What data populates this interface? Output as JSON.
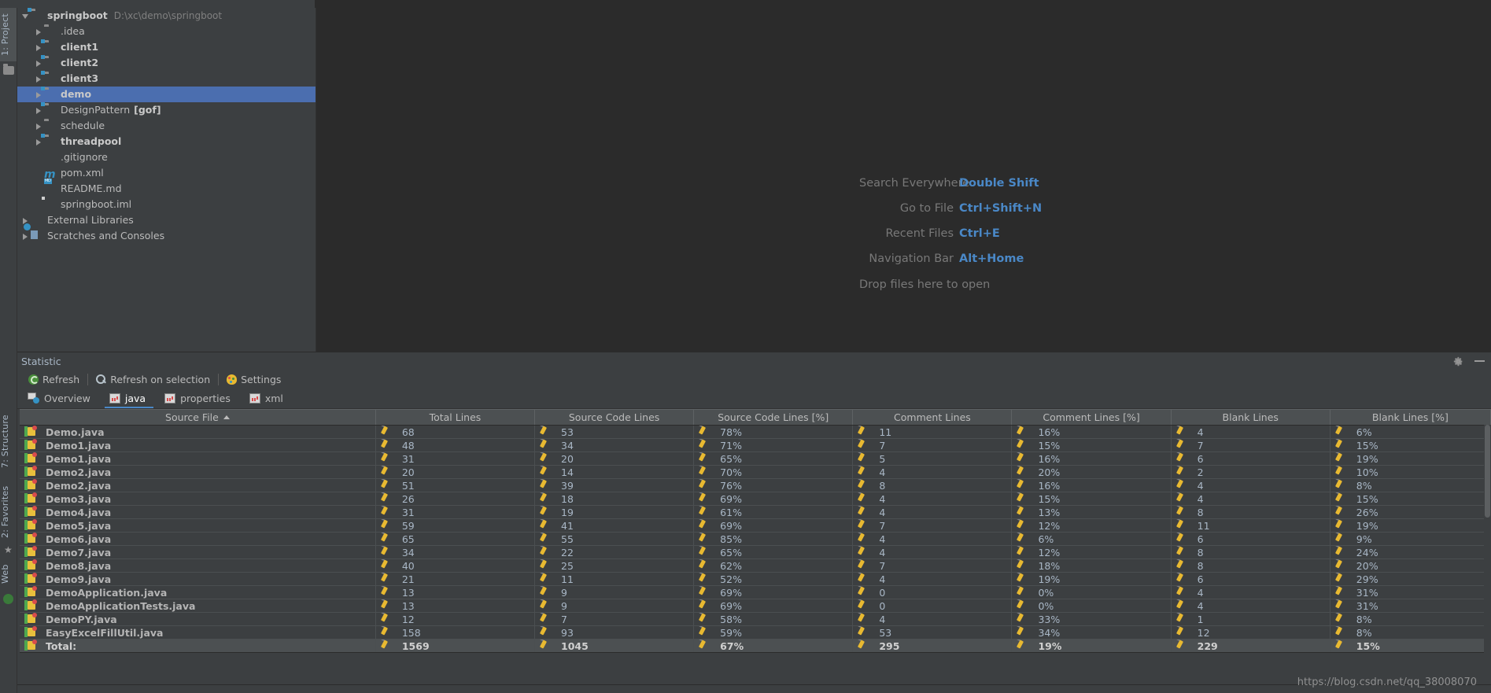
{
  "vertical_tabs_left": [
    {
      "label": "1: Project",
      "num": "1",
      "selected": true
    },
    {
      "label": "7: Structure",
      "num": "7",
      "selected": false
    },
    {
      "label": "2: Favorites",
      "num": "2",
      "selected": false
    },
    {
      "label": "Web",
      "num": "",
      "selected": false
    }
  ],
  "project_tree": {
    "items": [
      {
        "label": "springboot",
        "path": "D:\\xc\\demo\\springboot",
        "icon": "folder-module-icon",
        "arrow": "open",
        "indent": 0,
        "bold": true,
        "selected": false,
        "suffix": ""
      },
      {
        "label": ".idea",
        "path": "",
        "icon": "folder-icon",
        "arrow": "closed",
        "indent": 1,
        "bold": false,
        "selected": false,
        "suffix": ""
      },
      {
        "label": "client1",
        "path": "",
        "icon": "folder-module-icon",
        "arrow": "closed",
        "indent": 1,
        "bold": true,
        "selected": false,
        "suffix": ""
      },
      {
        "label": "client2",
        "path": "",
        "icon": "folder-module-icon",
        "arrow": "closed",
        "indent": 1,
        "bold": true,
        "selected": false,
        "suffix": ""
      },
      {
        "label": "client3",
        "path": "",
        "icon": "folder-module-icon",
        "arrow": "closed",
        "indent": 1,
        "bold": true,
        "selected": false,
        "suffix": ""
      },
      {
        "label": "demo",
        "path": "",
        "icon": "folder-module-icon",
        "arrow": "closed",
        "indent": 1,
        "bold": true,
        "selected": true,
        "suffix": ""
      },
      {
        "label": "DesignPattern",
        "path": "",
        "icon": "folder-module-icon",
        "arrow": "closed",
        "indent": 1,
        "bold": false,
        "selected": false,
        "suffix": "[gof]"
      },
      {
        "label": "schedule",
        "path": "",
        "icon": "folder-icon",
        "arrow": "closed",
        "indent": 1,
        "bold": false,
        "selected": false,
        "suffix": ""
      },
      {
        "label": "threadpool",
        "path": "",
        "icon": "folder-module-icon",
        "arrow": "closed",
        "indent": 1,
        "bold": true,
        "selected": false,
        "suffix": ""
      },
      {
        "label": ".gitignore",
        "path": "",
        "icon": "file-icon",
        "arrow": "none",
        "indent": 1,
        "bold": false,
        "selected": false,
        "suffix": ""
      },
      {
        "label": "pom.xml",
        "path": "",
        "icon": "maven-icon",
        "arrow": "none",
        "indent": 1,
        "bold": false,
        "selected": false,
        "suffix": ""
      },
      {
        "label": "README.md",
        "path": "",
        "icon": "markdown-icon",
        "arrow": "none",
        "indent": 1,
        "bold": false,
        "selected": false,
        "suffix": ""
      },
      {
        "label": "springboot.iml",
        "path": "",
        "icon": "iml-icon",
        "arrow": "none",
        "indent": 1,
        "bold": false,
        "selected": false,
        "suffix": ""
      },
      {
        "label": "External Libraries",
        "path": "",
        "icon": "libraries-icon",
        "arrow": "closed",
        "indent": 0,
        "bold": false,
        "selected": false,
        "suffix": ""
      },
      {
        "label": "Scratches and Consoles",
        "path": "",
        "icon": "scratches-icon",
        "arrow": "closed",
        "indent": 0,
        "bold": false,
        "selected": false,
        "suffix": ""
      }
    ]
  },
  "editor_hints": [
    {
      "label": "Search Everywhere",
      "key": "Double Shift"
    },
    {
      "label": "Go to File",
      "key": "Ctrl+Shift+N"
    },
    {
      "label": "Recent Files",
      "key": "Ctrl+E"
    },
    {
      "label": "Navigation Bar",
      "key": "Alt+Home"
    },
    {
      "label": "Drop files here to open",
      "key": ""
    }
  ],
  "statistic": {
    "title": "Statistic",
    "settings_icon": "gear-icon",
    "minimize_icon": "minimize-icon",
    "toolbar": [
      {
        "label": "Refresh",
        "icon": "refresh-icon"
      },
      {
        "label": "Refresh on selection",
        "icon": "magnifier-icon"
      },
      {
        "label": "Settings",
        "icon": "palette-icon"
      }
    ],
    "tabs": [
      {
        "label": "Overview",
        "icon": "overview-icon",
        "active": false
      },
      {
        "label": "java",
        "icon": "chart-icon",
        "active": true
      },
      {
        "label": "properties",
        "icon": "chart-icon",
        "active": false
      },
      {
        "label": "xml",
        "icon": "chart-icon",
        "active": false
      }
    ]
  },
  "chart_data": {
    "type": "table",
    "title": "Statistic - java",
    "sort_column": "Source File",
    "sort_direction": "asc",
    "columns": [
      "Source File",
      "Total Lines",
      "Source Code Lines",
      "Source Code Lines [%]",
      "Comment Lines",
      "Comment Lines [%]",
      "Blank Lines",
      "Blank Lines [%]"
    ],
    "rows": [
      [
        "Demo.java",
        "68",
        "53",
        "78%",
        "11",
        "16%",
        "4",
        "6%"
      ],
      [
        "Demo1.java",
        "48",
        "34",
        "71%",
        "7",
        "15%",
        "7",
        "15%"
      ],
      [
        "Demo1.java",
        "31",
        "20",
        "65%",
        "5",
        "16%",
        "6",
        "19%"
      ],
      [
        "Demo2.java",
        "20",
        "14",
        "70%",
        "4",
        "20%",
        "2",
        "10%"
      ],
      [
        "Demo2.java",
        "51",
        "39",
        "76%",
        "8",
        "16%",
        "4",
        "8%"
      ],
      [
        "Demo3.java",
        "26",
        "18",
        "69%",
        "4",
        "15%",
        "4",
        "15%"
      ],
      [
        "Demo4.java",
        "31",
        "19",
        "61%",
        "4",
        "13%",
        "8",
        "26%"
      ],
      [
        "Demo5.java",
        "59",
        "41",
        "69%",
        "7",
        "12%",
        "11",
        "19%"
      ],
      [
        "Demo6.java",
        "65",
        "55",
        "85%",
        "4",
        "6%",
        "6",
        "9%"
      ],
      [
        "Demo7.java",
        "34",
        "22",
        "65%",
        "4",
        "12%",
        "8",
        "24%"
      ],
      [
        "Demo8.java",
        "40",
        "25",
        "62%",
        "7",
        "18%",
        "8",
        "20%"
      ],
      [
        "Demo9.java",
        "21",
        "11",
        "52%",
        "4",
        "19%",
        "6",
        "29%"
      ],
      [
        "DemoApplication.java",
        "13",
        "9",
        "69%",
        "0",
        "0%",
        "4",
        "31%"
      ],
      [
        "DemoApplicationTests.java",
        "13",
        "9",
        "69%",
        "0",
        "0%",
        "4",
        "31%"
      ],
      [
        "DemoPY.java",
        "12",
        "7",
        "58%",
        "4",
        "33%",
        "1",
        "8%"
      ],
      [
        "EasyExcelFillUtil.java",
        "158",
        "93",
        "59%",
        "53",
        "34%",
        "12",
        "8%"
      ]
    ],
    "total_row": [
      "Total:",
      "1569",
      "1045",
      "67%",
      "295",
      "19%",
      "229",
      "15%"
    ],
    "row_icon": "java-file-icon",
    "cell_icon": "pencil-icon"
  },
  "watermark": "https://blog.csdn.net/qq_38008070",
  "colors": {
    "panel_bg": "#3c3f41",
    "editor_bg": "#2b2b2b",
    "selection": "#4b6eaf",
    "accent_link": "#4a88c7",
    "header_bg": "#4c5052",
    "text": "#a9b7c6"
  }
}
